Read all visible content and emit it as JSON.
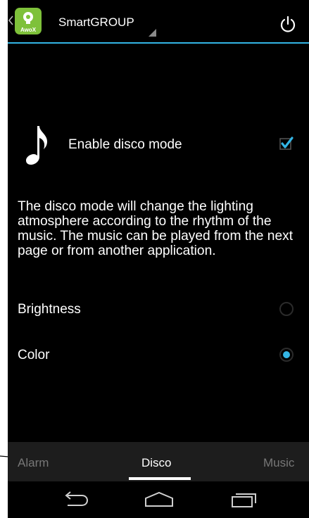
{
  "action_bar": {
    "logo_text": "AwoX",
    "title": "SmartGROUP"
  },
  "disco": {
    "label": "Enable disco mode",
    "checked": true,
    "description": "The disco mode will change the lighting atmosphere according to the rhythm of the music. The music can be played from the next page or from another application."
  },
  "options": [
    {
      "label": "Brightness",
      "selected": false
    },
    {
      "label": "Color",
      "selected": true
    }
  ],
  "tabs": [
    {
      "label": "Alarm",
      "active": false
    },
    {
      "label": "Disco",
      "active": true
    },
    {
      "label": "Music",
      "active": false
    }
  ],
  "colors": {
    "accent": "#33b5e5",
    "logo": "#7ec13a",
    "background": "#000000",
    "tab_strip": "#1d1d1d"
  },
  "icons": {
    "up": "chevron-left-icon",
    "logo": "awox-logo",
    "power": "power-icon",
    "note": "music-note-icon",
    "back": "back-icon",
    "home": "home-icon",
    "recents": "recents-icon"
  }
}
